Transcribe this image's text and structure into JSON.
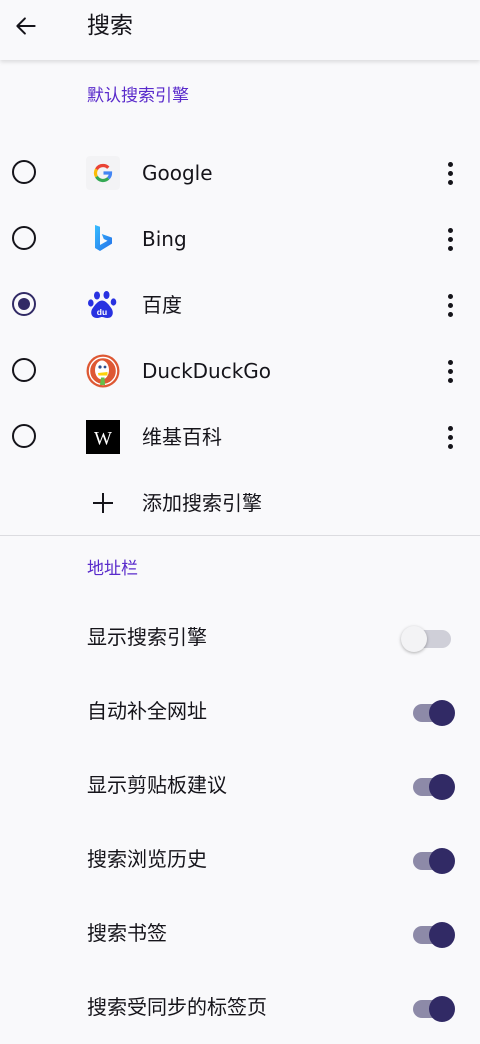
{
  "app_bar": {
    "title": "搜索"
  },
  "default_engine": {
    "header": "默认搜索引擎",
    "engines": [
      {
        "label": "Google",
        "icon": "google-icon",
        "selected": false
      },
      {
        "label": "Bing",
        "icon": "bing-icon",
        "selected": false
      },
      {
        "label": "百度",
        "icon": "baidu-icon",
        "selected": true
      },
      {
        "label": "DuckDuckGo",
        "icon": "duckduckgo-icon",
        "selected": false
      },
      {
        "label": "维基百科",
        "icon": "wikipedia-icon",
        "selected": false
      }
    ],
    "add_label": "添加搜索引擎",
    "wikipedia_glyph": "W",
    "baidu_glyph": "du"
  },
  "address_bar": {
    "header": "地址栏",
    "settings": [
      {
        "label": "显示搜索引擎",
        "enabled": false
      },
      {
        "label": "自动补全网址",
        "enabled": true
      },
      {
        "label": "显示剪贴板建议",
        "enabled": true
      },
      {
        "label": "搜索浏览历史",
        "enabled": true
      },
      {
        "label": "搜索书签",
        "enabled": true
      },
      {
        "label": "搜索受同步的标签页",
        "enabled": true
      }
    ]
  },
  "colors": {
    "accent": "#592acb",
    "switch_on_thumb": "#312a65",
    "switch_on_track": "#8d8aa8",
    "switch_off_track": "#cfcfd8",
    "background": "#f9f9fb"
  }
}
